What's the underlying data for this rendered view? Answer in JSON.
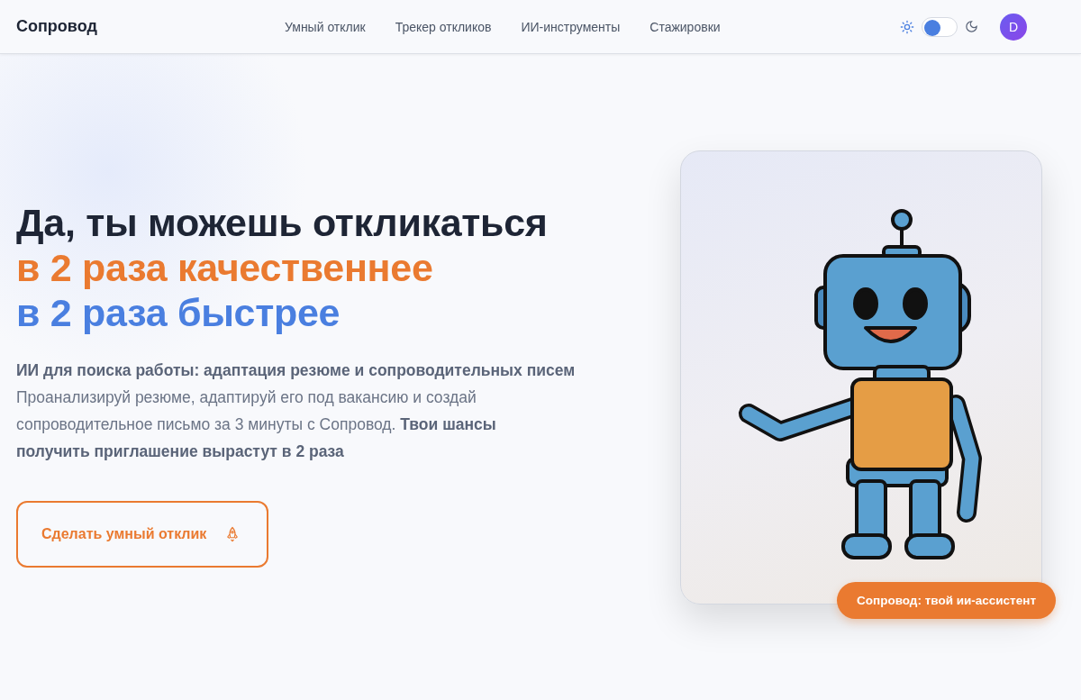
{
  "header": {
    "logo": "Сопровод",
    "nav": [
      {
        "label": "Умный отклик"
      },
      {
        "label": "Трекер откликов"
      },
      {
        "label": "ИИ-инструменты"
      },
      {
        "label": "Стажировки"
      }
    ],
    "theme_toggle": {
      "on": false
    },
    "avatar": "D"
  },
  "hero": {
    "headline": [
      {
        "text": "Да, ты можешь откликаться",
        "color": "#1e2535"
      },
      {
        "text": "в 2 раза качественнее",
        "color": "#ea7a30"
      },
      {
        "text": "в 2 раза быстрее",
        "color": "#4a7fe0"
      }
    ],
    "subtitle": "ИИ для поиска работы: адаптация резюме и сопроводительных писем",
    "description": "Проанализируй резюме, адаптируй его под вакансию и создай сопроводительное письмо за 3 минуты с Сопровод. **Твои шансы получить приглашение вырастут в 2 раза**",
    "cta": "Сделать умный отклик",
    "badge": "Сопровод: твой ии-ассистент"
  }
}
